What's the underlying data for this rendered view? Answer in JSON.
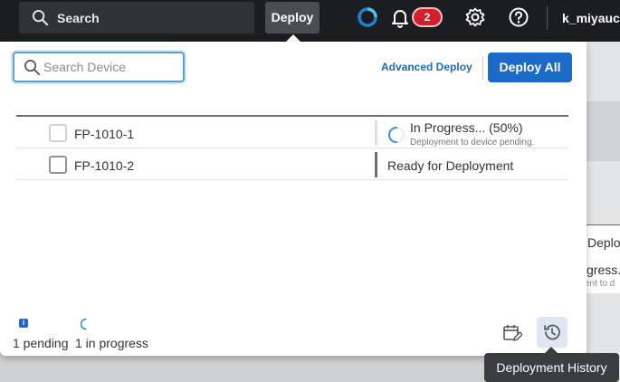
{
  "topbar": {
    "search_label": "Search",
    "deploy_label": "Deploy",
    "notification_count": "2",
    "user_name": "k_miyauc",
    "icons": [
      "search-icon",
      "status-swirl-icon",
      "bell-icon",
      "gear-icon",
      "help-icon"
    ]
  },
  "background_page": {
    "text_1": "Deplo",
    "text_2": "gress.",
    "text_3": "ent to d"
  },
  "dialog": {
    "search_placeholder": "Search Device",
    "advanced_deploy_label": "Advanced Deploy",
    "deploy_all_label": "Deploy All",
    "devices": [
      {
        "name": "FP-1010-1",
        "checkbox_disabled": true,
        "status": "In Progress... (50%)",
        "status_detail": "Deployment to device pending.",
        "progress_percent": 50
      },
      {
        "name": "FP-1010-2",
        "checkbox_disabled": false,
        "status": "Ready for Deployment",
        "status_detail": ""
      }
    ],
    "footer": {
      "info_glyph": "i",
      "pending_text": "1 pending",
      "in_progress_text": "1 in progress"
    },
    "history_tooltip": "Deployment History"
  },
  "colors": {
    "topbar_bg": "#1b1d21",
    "accent_blue": "#1b6ac9",
    "badge_red": "#d21f2e",
    "spinner_blue": "#3b8ee0"
  }
}
